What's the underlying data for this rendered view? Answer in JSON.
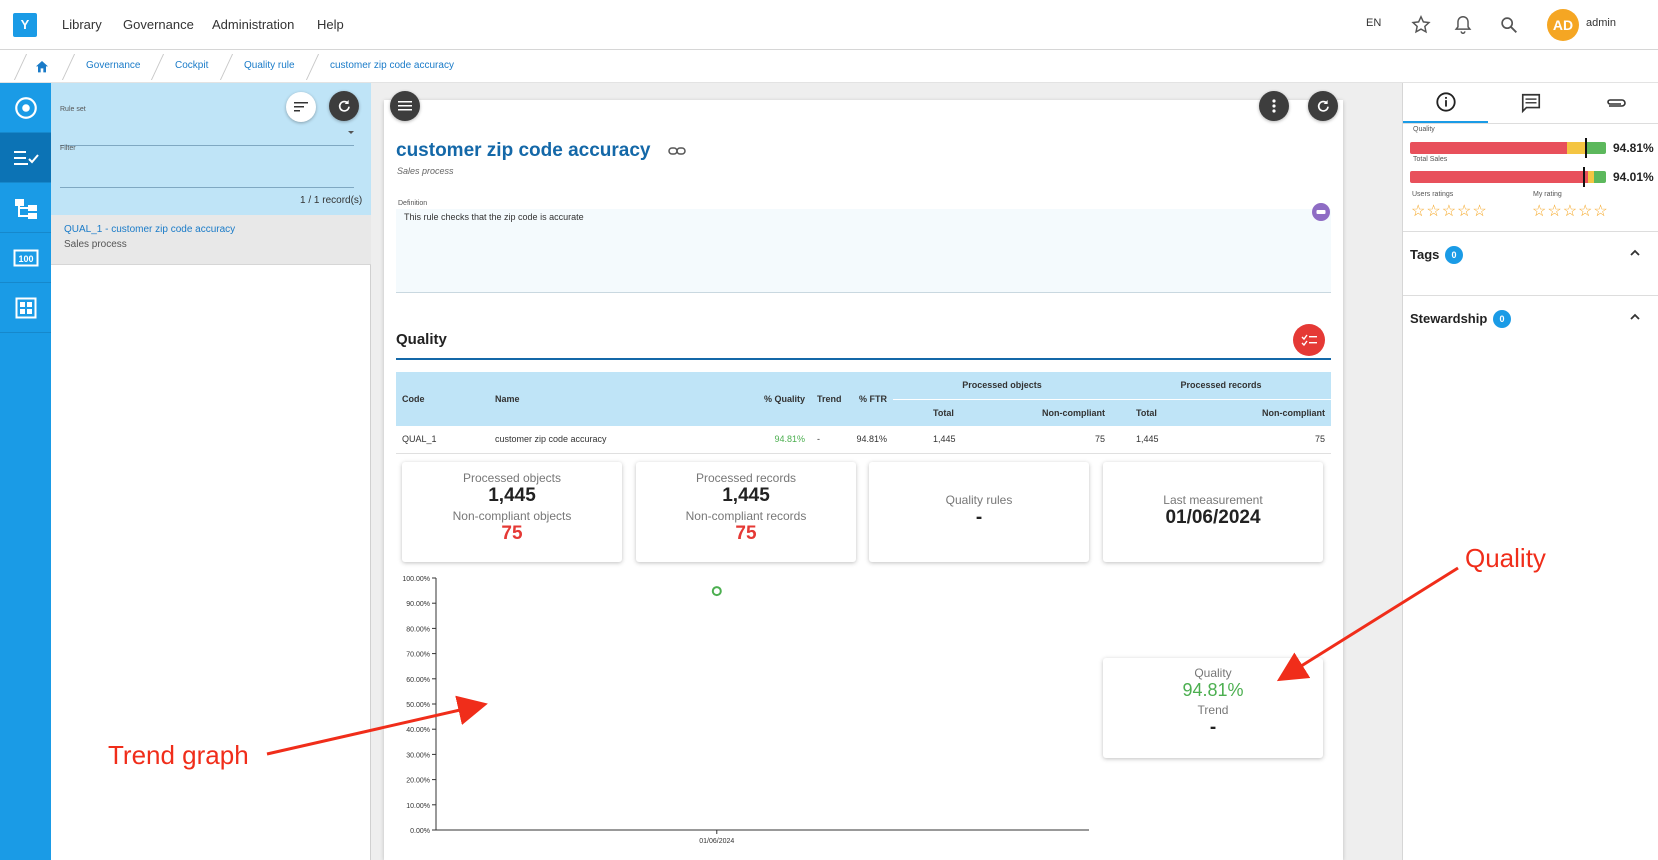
{
  "topbar": {
    "logo": "Y",
    "menu": [
      "Library",
      "Governance",
      "Administration",
      "Help"
    ],
    "lang": "EN",
    "avatar_initials": "AD",
    "username": "admin"
  },
  "breadcrumb": [
    "Governance",
    "Cockpit",
    "Quality rule",
    "customer zip code accuracy"
  ],
  "list_panel": {
    "ruleset_label": "Rule set",
    "filter_label": "Filter",
    "record_count": "1 / 1 record(s)",
    "items": [
      {
        "title": "QUAL_1 - customer zip code accuracy",
        "subtitle": "Sales process"
      }
    ]
  },
  "main": {
    "title": "customer zip code accuracy",
    "subtitle": "Sales process",
    "definition_label": "Definition",
    "definition_text": "This rule checks that the zip code is accurate",
    "quality_section_title": "Quality",
    "table": {
      "headers": {
        "code": "Code",
        "name": "Name",
        "pct_quality": "% Quality",
        "trend": "Trend",
        "pct_ftr": "% FTR",
        "processed_objects": "Processed objects",
        "processed_records": "Processed records",
        "total": "Total",
        "non_compliant": "Non-compliant"
      },
      "row": {
        "code": "QUAL_1",
        "name": "customer zip code accuracy",
        "pct_quality": "94.81%",
        "trend": "-",
        "pct_ftr": "94.81%",
        "obj_total": "1,445",
        "obj_nc": "75",
        "rec_total": "1,445",
        "rec_nc": "75"
      }
    },
    "kpis": {
      "processed_objects_label": "Processed objects",
      "processed_objects_value": "1,445",
      "nc_objects_label": "Non-compliant objects",
      "nc_objects_value": "75",
      "processed_records_label": "Processed records",
      "processed_records_value": "1,445",
      "nc_records_label": "Non-compliant records",
      "nc_records_value": "75",
      "quality_rules_label": "Quality rules",
      "quality_rules_value": "-",
      "last_measurement_label": "Last measurement",
      "last_measurement_value": "01/06/2024",
      "quality_label": "Quality",
      "quality_value": "94.81%",
      "trend_label": "Trend",
      "trend_value": "-"
    }
  },
  "chart_data": {
    "type": "scatter",
    "x": [
      "01/06/2024"
    ],
    "y": [
      94.81
    ],
    "yticks": [
      "0.00%",
      "10.00%",
      "20.00%",
      "30.00%",
      "40.00%",
      "50.00%",
      "60.00%",
      "70.00%",
      "80.00%",
      "90.00%",
      "100.00%"
    ],
    "ylim": [
      0,
      100
    ],
    "xtick_labels": [
      "01/06/2024"
    ],
    "point_color": "#4caf50"
  },
  "right_panel": {
    "quality_label": "Quality",
    "quality_value": "94.81%",
    "quality_level": 94.81,
    "total_sales_label": "Total Sales",
    "total_sales_value": "94.01%",
    "total_sales_level": 94.01,
    "users_ratings_label": "Users ratings",
    "my_rating_label": "My rating",
    "tags_label": "Tags",
    "tags_count": "0",
    "stewardship_label": "Stewardship",
    "stewardship_count": "0"
  },
  "annotations": {
    "trend_graph": "Trend graph",
    "quality": "Quality"
  },
  "colors": {
    "accent": "#1a9be6",
    "title": "#1468a8",
    "red": "#e53935",
    "green": "#4caf50",
    "annotation": "#f02d1a"
  }
}
